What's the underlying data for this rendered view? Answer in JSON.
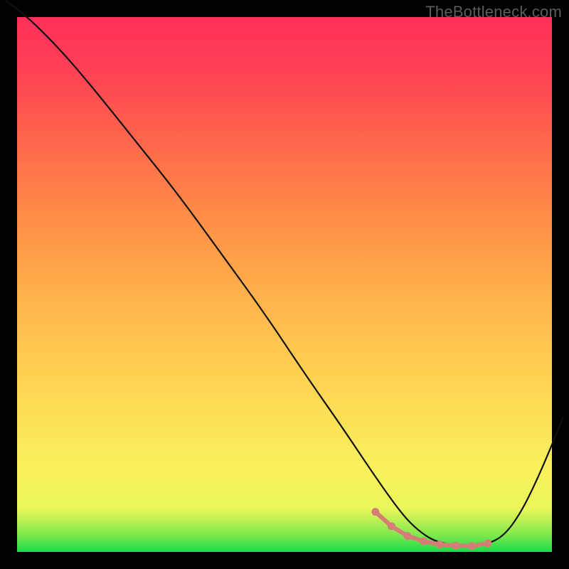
{
  "watermark": "TheBottleneck.com",
  "chart_data": {
    "type": "line",
    "title": "",
    "xlabel": "",
    "ylabel": "",
    "xlim": [
      0,
      100
    ],
    "ylim": [
      0,
      100
    ],
    "grid": false,
    "series": [
      {
        "name": "bottleneck-curve",
        "x": [
          -2,
          2,
          8,
          14,
          22,
          30,
          38,
          46,
          54,
          61,
          67,
          72,
          75,
          78,
          82,
          85,
          88,
          91,
          94,
          97,
          100,
          102
        ],
        "values": [
          103,
          100,
          94,
          87,
          77,
          67,
          56,
          45,
          33,
          23,
          14,
          7,
          4,
          2,
          1.2,
          1,
          1.5,
          3,
          7,
          13,
          20,
          25
        ]
      }
    ],
    "highlight": {
      "name": "optimal-range",
      "x": [
        67,
        70,
        73,
        76,
        79,
        82,
        85,
        88
      ],
      "values": [
        7.5,
        4.8,
        3,
        2,
        1.4,
        1.2,
        1.1,
        1.6
      ]
    },
    "colors": {
      "curve": "#111111",
      "highlight": "#d77d78",
      "gradient_top": "#ff2f5a",
      "gradient_bottom": "#18db4a"
    }
  }
}
